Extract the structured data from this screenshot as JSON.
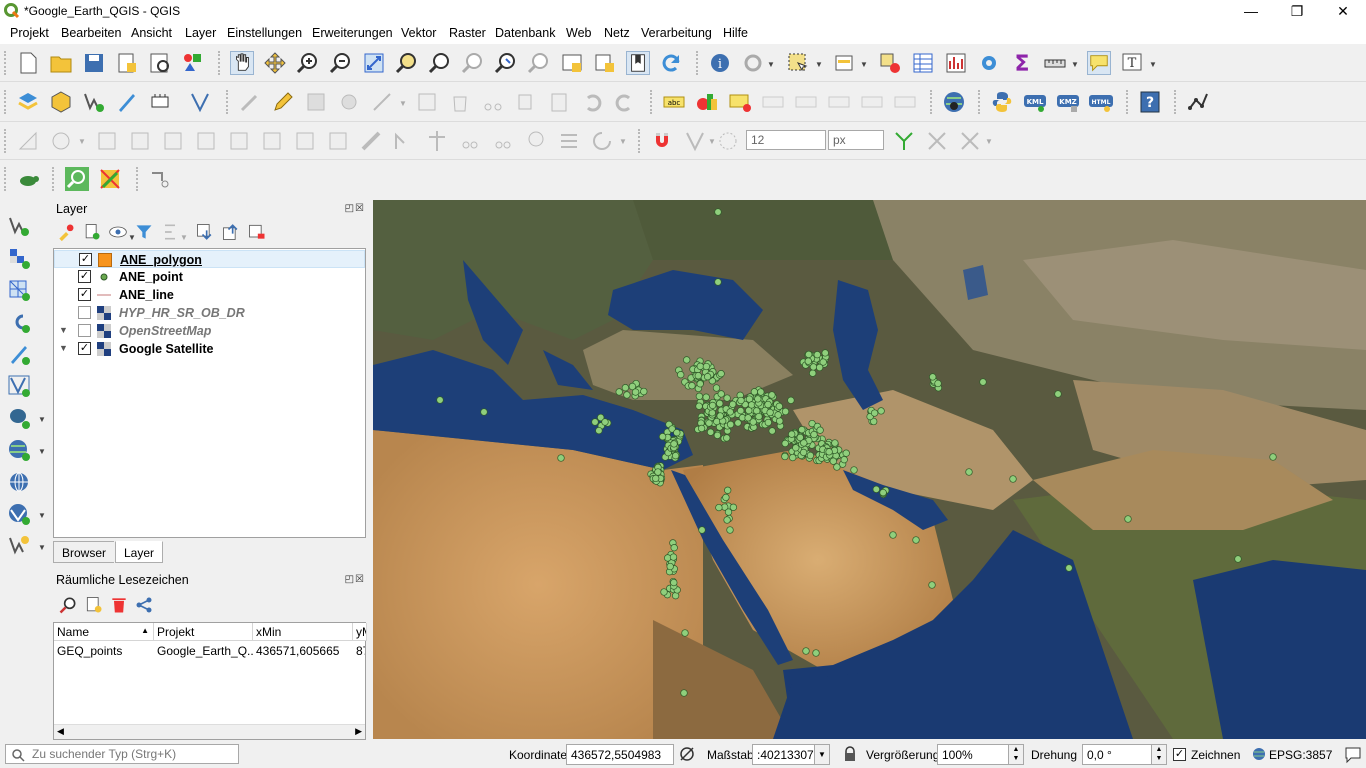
{
  "window": {
    "title": "*Google_Earth_QGIS - QGIS",
    "minimize": "—",
    "maximize": "❐",
    "close": "✕"
  },
  "menus": [
    {
      "label": "Projekt"
    },
    {
      "label": "Bearbeiten"
    },
    {
      "label": "Ansicht"
    },
    {
      "label": "Layer"
    },
    {
      "label": "Einstellungen"
    },
    {
      "label": "Erweiterungen"
    },
    {
      "label": "Vektor"
    },
    {
      "label": "Raster"
    },
    {
      "label": "Datenbank"
    },
    {
      "label": "Web"
    },
    {
      "label": "Netz"
    },
    {
      "label": "Verarbeitung"
    },
    {
      "label": "Hilfe"
    }
  ],
  "toolbar": {
    "snap_tolerance": "12",
    "snap_unit": "px"
  },
  "layers_panel": {
    "title": "Layer",
    "layers": [
      {
        "name": "ANE_polygon",
        "checked": true,
        "symbol": "polygon",
        "color": "#f7941d"
      },
      {
        "name": "ANE_point",
        "checked": true,
        "symbol": "point",
        "color": "#6aa84f"
      },
      {
        "name": "ANE_line",
        "checked": true,
        "symbol": "line",
        "color": "#d9a6a6"
      },
      {
        "name": "HYP_HR_SR_OB_DR",
        "checked": false,
        "symbol": "raster"
      },
      {
        "name": "OpenStreetMap",
        "checked": false,
        "symbol": "raster"
      },
      {
        "name": "Google Satellite",
        "checked": true,
        "symbol": "raster"
      }
    ],
    "tabs": {
      "browser": "Browser",
      "layer": "Layer"
    }
  },
  "bookmarks_panel": {
    "title": "Räumliche Lesezeichen",
    "columns": [
      "Name",
      "Projekt",
      "xMin",
      "yM"
    ],
    "rows": [
      [
        "GEQ_points",
        "Google_Earth_Q...",
        "436571,605665",
        "87"
      ]
    ]
  },
  "map": {
    "point_color": "#8fcf7c",
    "point_stroke": "#2f5a28"
  },
  "status": {
    "search_placeholder": "Zu suchender Typ (Strg+K)",
    "coord_label": "Koordinate",
    "coord_value": "436572,5504983",
    "scale_label": "Maßstab",
    "scale_value": ":40213307",
    "magnifier_label": "Vergrößerung",
    "magnifier_value": "100%",
    "rotation_label": "Drehung",
    "rotation_value": "0,0 °",
    "render_label": "Zeichnen",
    "crs": "EPSG:3857"
  }
}
